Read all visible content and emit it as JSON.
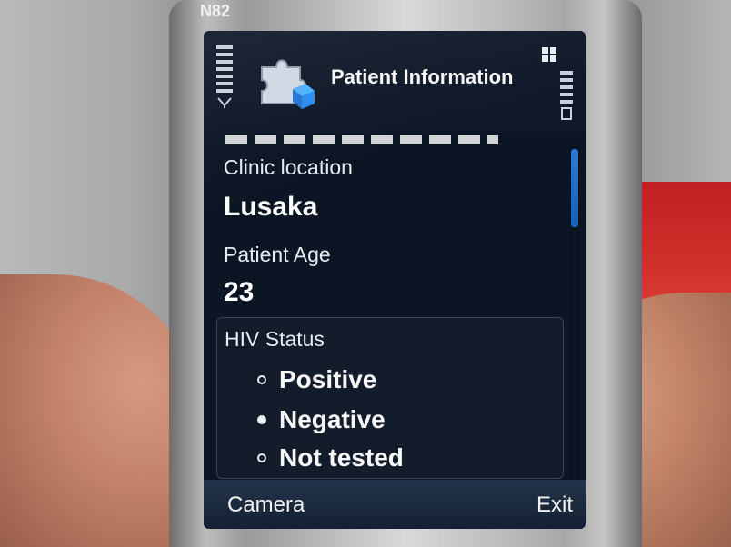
{
  "device": {
    "model": "N82"
  },
  "header": {
    "title": "Patient Information",
    "app_icon": "puzzle-piece-icon",
    "menu_icon": "grid-icon"
  },
  "form": {
    "clinic_location": {
      "label": "Clinic location",
      "value": "Lusaka"
    },
    "patient_age": {
      "label": "Patient Age",
      "value": "23"
    },
    "hiv_status": {
      "label": "HIV Status",
      "options": [
        {
          "label": "Positive",
          "selected": false
        },
        {
          "label": "Negative",
          "selected": true
        },
        {
          "label": "Not tested",
          "selected": false
        }
      ]
    }
  },
  "softkeys": {
    "left": "Camera",
    "right": "Exit"
  },
  "colors": {
    "screen_bg": "#0b1524",
    "scroll_thumb": "#2f77d1",
    "softkey_bar": "#1b2a3f"
  }
}
